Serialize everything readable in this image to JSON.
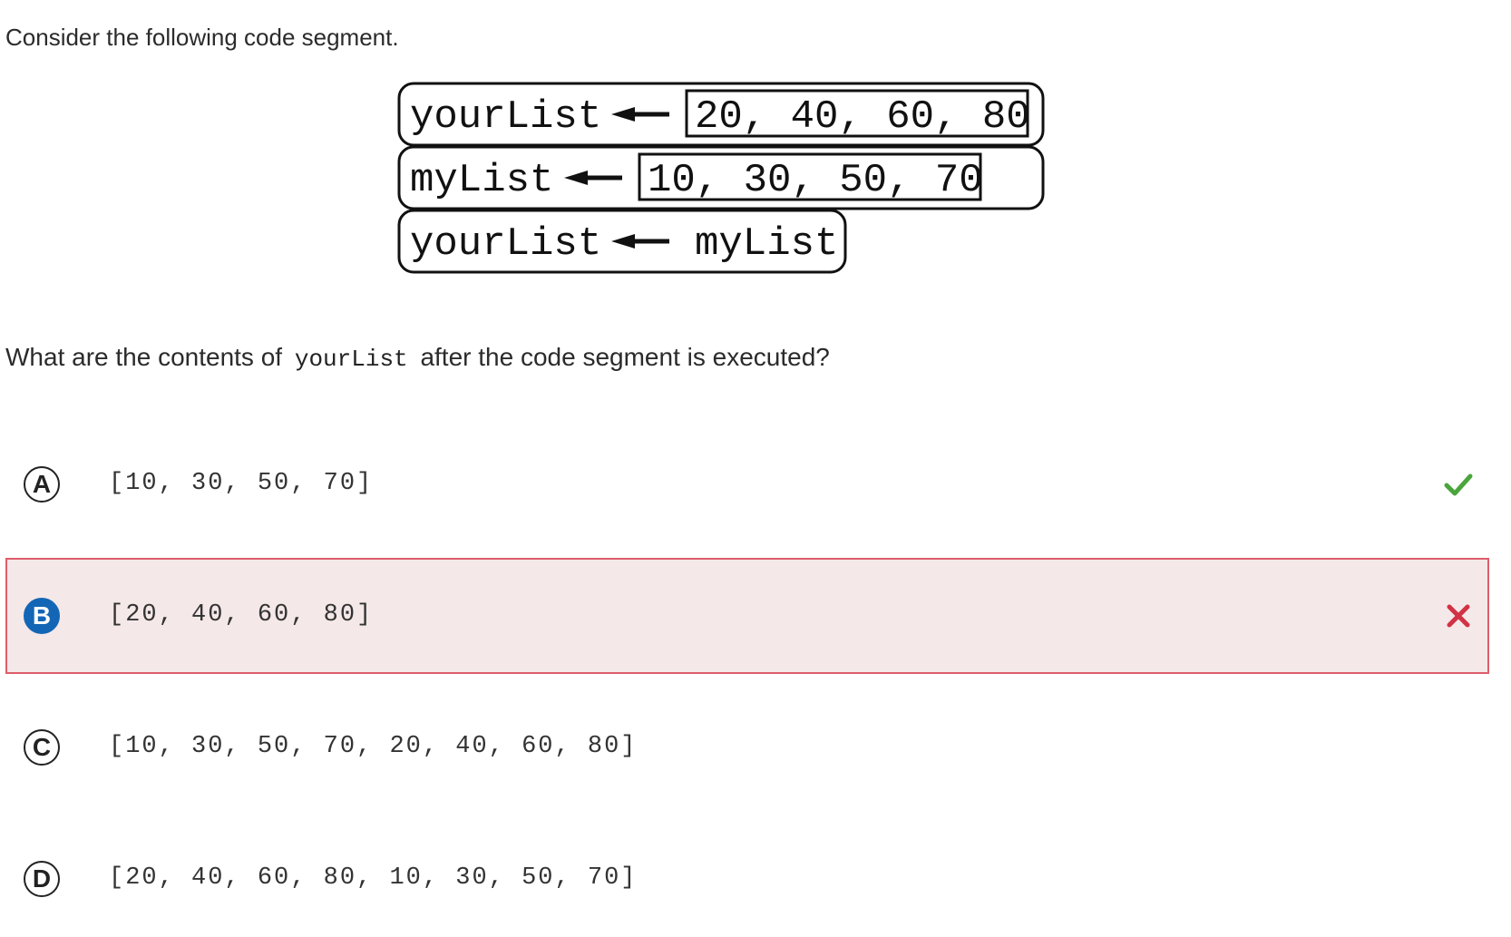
{
  "question": {
    "intro": "Consider the following code segment.",
    "prompt_before": "What are the contents of",
    "prompt_code": "yourList",
    "prompt_after": "after the code segment is executed?"
  },
  "code_diagram": {
    "lines": [
      {
        "target": "yourList",
        "value": "20, 40, 60, 80",
        "value_boxed": true
      },
      {
        "target": "myList",
        "value": "10, 30, 50, 70",
        "value_boxed": true
      },
      {
        "target": "yourList",
        "value": "myList",
        "value_boxed": false
      }
    ],
    "arrow_icon": "left-arrow-icon"
  },
  "choices": [
    {
      "letter": "A",
      "text": "[10, 30, 50, 70]",
      "selected": false,
      "mark": "correct-check-icon"
    },
    {
      "letter": "B",
      "text": "[20, 40, 60, 80]",
      "selected": true,
      "mark": "incorrect-x-icon"
    },
    {
      "letter": "C",
      "text": "[10, 30, 50, 70, 20, 40, 60, 80]",
      "selected": false,
      "mark": ""
    },
    {
      "letter": "D",
      "text": "[20, 40, 60, 80, 10, 30, 50, 70]",
      "selected": false,
      "mark": ""
    }
  ],
  "colors": {
    "correct": "#4aa53c",
    "incorrect": "#d13245",
    "selected_badge": "#1366b5",
    "selected_bg": "#f5e8e9",
    "selected_border": "#de5d6a"
  }
}
